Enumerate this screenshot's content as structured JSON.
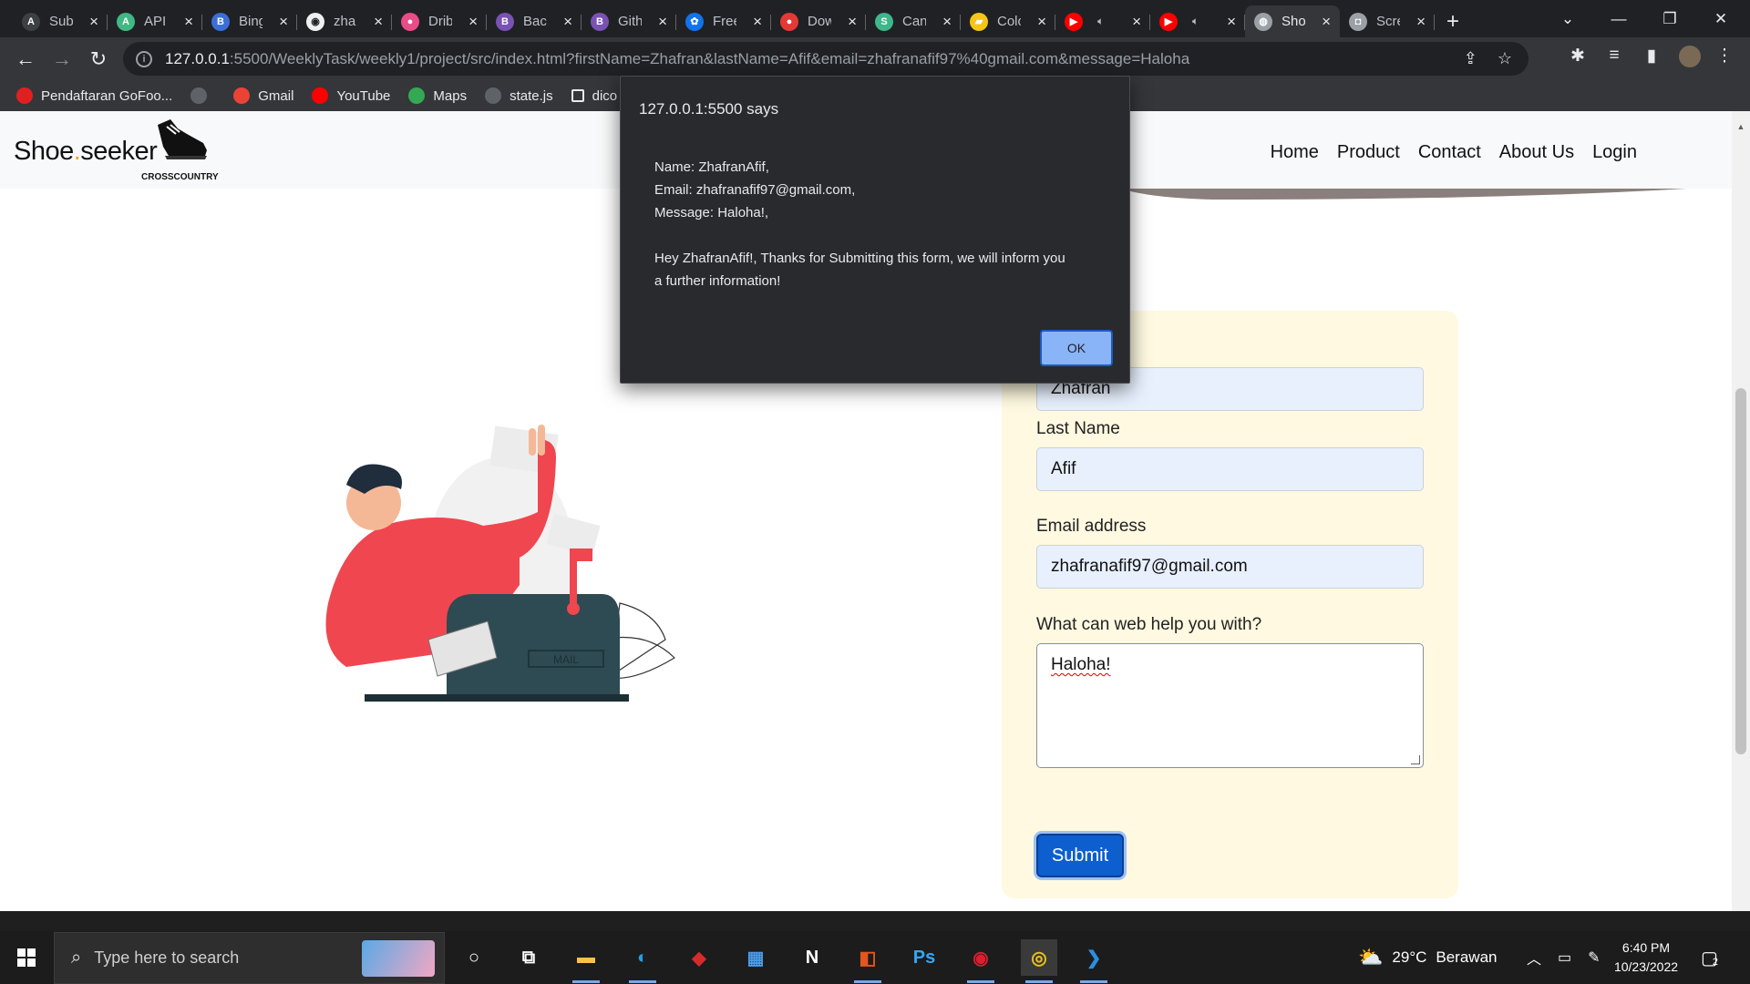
{
  "browser": {
    "tabs": [
      {
        "title": "Sub",
        "icon": "a-icon",
        "color": "#3c4043",
        "glyph": "A"
      },
      {
        "title": "API",
        "icon": "vue-icon",
        "color": "#41b883",
        "glyph": "A"
      },
      {
        "title": "Bing",
        "icon": "bing-translate-icon",
        "color": "#3b6fd6",
        "glyph": "B"
      },
      {
        "title": "zha",
        "icon": "github-icon",
        "color": "#f0f0f0",
        "glyph": "◉"
      },
      {
        "title": "Drib",
        "icon": "dribbble-icon",
        "color": "#ea4c89",
        "glyph": "●"
      },
      {
        "title": "Back",
        "icon": "bootstrap-icon",
        "color": "#7952b3",
        "glyph": "B"
      },
      {
        "title": "Gith",
        "icon": "bootstrap-icon",
        "color": "#7952b3",
        "glyph": "B"
      },
      {
        "title": "Free",
        "icon": "freepik-icon",
        "color": "#1273eb",
        "glyph": "✿"
      },
      {
        "title": "Dow",
        "icon": "download-icon",
        "color": "#e53935",
        "glyph": "●"
      },
      {
        "title": "Can",
        "icon": "styled-icon",
        "color": "#3fb68b",
        "glyph": "S"
      },
      {
        "title": "Colo",
        "icon": "color-icon",
        "color": "#f5c518",
        "glyph": "▰"
      },
      {
        "title": "",
        "icon": "youtube-icon",
        "color": "#ff0000",
        "glyph": "▶",
        "audio": true
      },
      {
        "title": "",
        "icon": "youtube-icon",
        "color": "#ff0000",
        "glyph": "▶",
        "audio": true
      },
      {
        "title": "Sho",
        "icon": "globe-icon",
        "color": "#9aa0a6",
        "glyph": "◍",
        "active": true
      },
      {
        "title": "Scre",
        "icon": "camera-icon",
        "color": "#9aa0a6",
        "glyph": "◘"
      }
    ],
    "url_host": "127.0.0.1",
    "url_rest": ":5500/WeeklyTask/weekly1/project/src/index.html?firstName=Zhafran&lastName=Afif&email=zhafranafif97%40gmail.com&message=Haloha",
    "bookmarks": [
      {
        "label": "Pendaftaran GoFoo...",
        "icon": "gofood-icon",
        "color": "#e02020"
      },
      {
        "label": "",
        "icon": "globe-icon",
        "color": "#5f6368"
      },
      {
        "label": "Gmail",
        "icon": "gmail-icon",
        "color": "#ea4335"
      },
      {
        "label": "YouTube",
        "icon": "youtube-icon",
        "color": "#ff0000"
      },
      {
        "label": "Maps",
        "icon": "maps-icon",
        "color": "#34a853"
      },
      {
        "label": "state.js",
        "icon": "globe-icon",
        "color": "#5f6368"
      },
      {
        "label": "dico",
        "icon": "page-icon",
        "color": "#35363a"
      }
    ]
  },
  "site": {
    "brand_main": "Shoe",
    "brand_dot": ".",
    "brand_end": "seeker",
    "brand_sub": "CROSSCOUNTRY",
    "nav": [
      "Home",
      "Product",
      "Contact",
      "About Us",
      "Login"
    ],
    "illustration_label": "MAIL",
    "form": {
      "first_value": "Zhafran",
      "last_label": "Last Name",
      "last_value": "Afif",
      "email_label": "Email address",
      "email_value": "zhafranafif97@gmail.com",
      "message_label": "What can web help you with?",
      "message_value": "Haloha!",
      "submit_label": "Submit"
    }
  },
  "alert": {
    "title": "127.0.0.1:5500 says",
    "line_name": "Name: ZhafranAfif,",
    "line_email": "Email: zhafranafif97@gmail.com,",
    "line_message": "Message: Haloha!,",
    "line_thanks": "Hey ZhafranAfif!, Thanks for Submitting this form, we will inform you a further information!",
    "ok_label": "OK"
  },
  "taskbar": {
    "search_placeholder": "Type here to search",
    "apps": [
      {
        "name": "cortana-icon",
        "glyph": "○",
        "color": "#ffffff"
      },
      {
        "name": "task-view-icon",
        "glyph": "⧉",
        "color": "#ffffff"
      },
      {
        "name": "file-explorer-icon",
        "glyph": "▬",
        "color": "#f6c343"
      },
      {
        "name": "edge-icon",
        "glyph": "◐",
        "color": "#1fa1e8"
      },
      {
        "name": "vpn-icon",
        "glyph": "◆",
        "color": "#d62b2b"
      },
      {
        "name": "store-icon",
        "glyph": "▦",
        "color": "#4b9be8"
      },
      {
        "name": "notion-icon",
        "glyph": "N",
        "color": "#ffffff"
      },
      {
        "name": "office-icon",
        "glyph": "◧",
        "color": "#e3561f"
      },
      {
        "name": "photoshop-icon",
        "glyph": "Ps",
        "color": "#31a8ff"
      },
      {
        "name": "app-red-icon",
        "glyph": "◉",
        "color": "#e01b2f"
      },
      {
        "name": "chrome-icon",
        "glyph": "◎",
        "color": "#e8c21a"
      },
      {
        "name": "vscode-icon",
        "glyph": "❯",
        "color": "#2a8fe0"
      }
    ],
    "weather_temp": "29°C",
    "weather_text": "Berawan",
    "time": "6:40 PM",
    "date": "10/23/2022",
    "notification_count": "2"
  },
  "colors": {
    "accent": "#0d5ecf",
    "form_bg": "#fef9e0",
    "input_bg": "#e8f0fe",
    "alert_bg": "#292a2d",
    "alert_ok": "#8ab4f8"
  }
}
